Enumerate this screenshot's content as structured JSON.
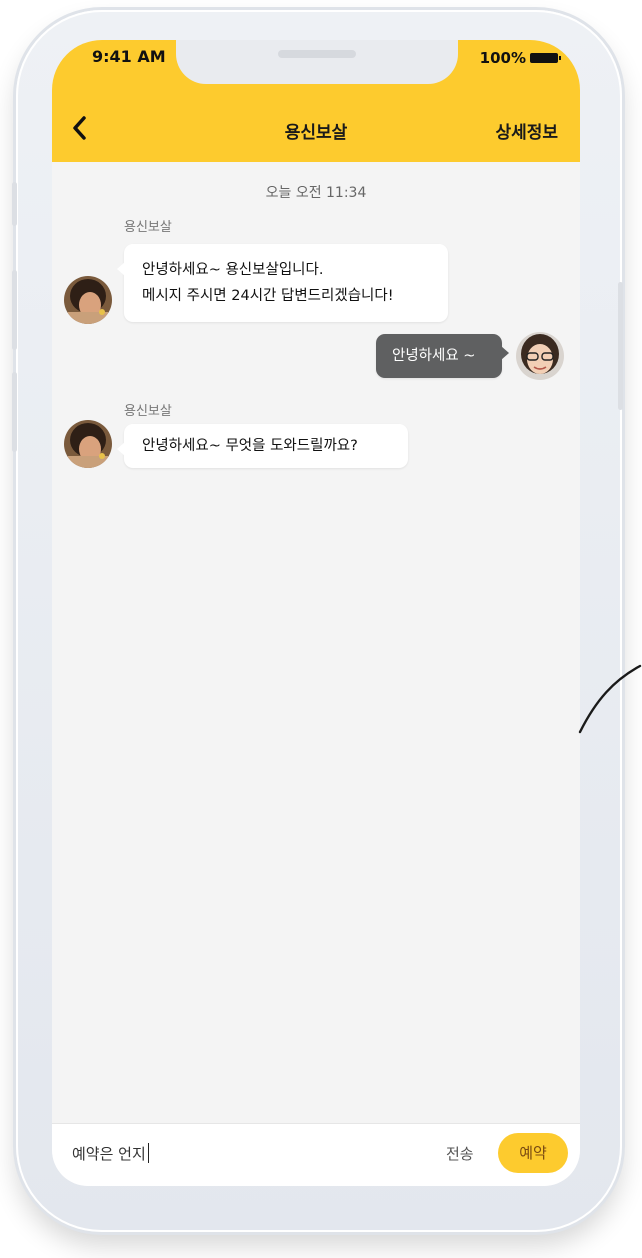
{
  "status_bar": {
    "time": "9:41 AM",
    "battery": "100%"
  },
  "header": {
    "title": "용신보살",
    "detail_label": "상세정보",
    "back_icon": "chevron-left-icon"
  },
  "chat": {
    "timestamp": "오늘 오전 11:34",
    "messages": [
      {
        "direction": "in",
        "sender": "용신보살",
        "lines": [
          "안녕하세요~ 용신보살입니다.",
          "메시지 주시면 24시간 답변드리겠습니다!"
        ]
      },
      {
        "direction": "out",
        "lines": [
          "안녕하세요 ~"
        ]
      },
      {
        "direction": "in",
        "sender": "용신보살",
        "lines": [
          "안녕하세요~ 무엇을 도와드릴까요?"
        ]
      }
    ]
  },
  "input": {
    "value": "예약은 언지",
    "send_label": "전송",
    "reserve_label": "예약"
  },
  "colors": {
    "accent": "#fdcb2e",
    "background": "#f4f4f4",
    "outgoing_bubble": "#5f6061"
  }
}
